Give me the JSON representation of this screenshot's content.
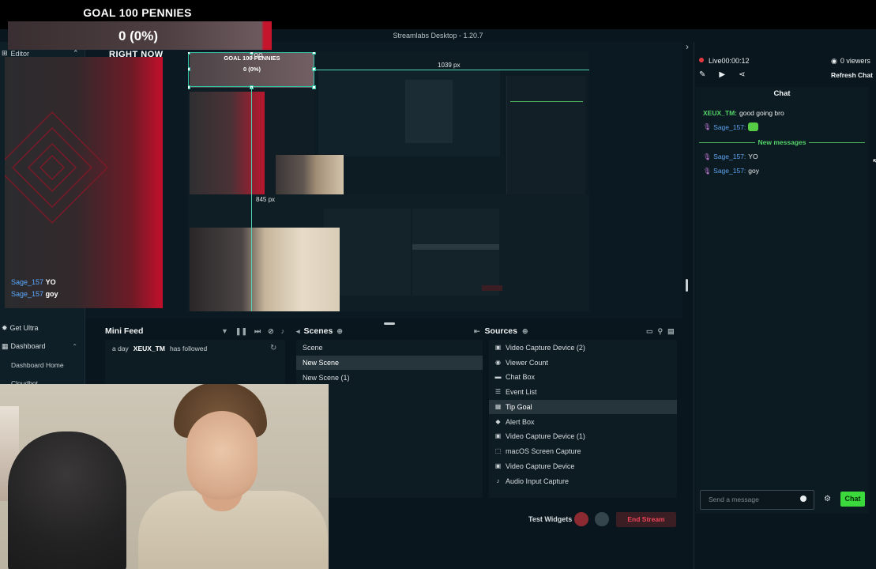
{
  "window": {
    "title": "Streamlabs Desktop - 1.20.7"
  },
  "goal_overlay": {
    "title": "GOAL 100 PENNIES",
    "value": "0 (0%)",
    "progress": 0,
    "subtitle": "RIGHT NOW"
  },
  "left_nav": {
    "editor_label": "Editor",
    "items": [
      {
        "label": "Get Ultra"
      },
      {
        "label": "Dashboard"
      },
      {
        "label": "Dashboard Home"
      },
      {
        "label": "Cloudbot"
      }
    ]
  },
  "preview": {
    "width_label": "1039 px",
    "height_label": "845 px",
    "nested_goal_title": "GOAL 100 PENNIES",
    "nested_goal_value": "0 (0%)",
    "nested_value_marker": "100"
  },
  "overlay_chat": [
    {
      "user": "Sage_157",
      "message": "YO"
    },
    {
      "user": "Sage_157",
      "message": "goy"
    }
  ],
  "mini_feed": {
    "title": "Mini Feed",
    "events": [
      {
        "time": "a day",
        "user": "XEUX_TM",
        "action": "has followed"
      }
    ]
  },
  "scenes": {
    "title": "Scenes",
    "items": [
      {
        "label": "Scene",
        "selected": false
      },
      {
        "label": "New Scene",
        "selected": true
      },
      {
        "label": "New Scene (1)",
        "selected": false
      }
    ]
  },
  "sources": {
    "title": "Sources",
    "items": [
      {
        "label": "Video Capture Device (2)",
        "icon": "camera-icon",
        "selected": false
      },
      {
        "label": "Viewer Count",
        "icon": "eye-icon",
        "selected": false
      },
      {
        "label": "Chat Box",
        "icon": "chat-icon",
        "selected": false
      },
      {
        "label": "Event List",
        "icon": "list-icon",
        "selected": false
      },
      {
        "label": "Tip Goal",
        "icon": "calendar-icon",
        "selected": true
      },
      {
        "label": "Alert Box",
        "icon": "bell-icon",
        "selected": false
      },
      {
        "label": "Video Capture Device (1)",
        "icon": "camera-icon",
        "selected": false
      },
      {
        "label": "macOS Screen Capture",
        "icon": "screen-capture-icon",
        "selected": false
      },
      {
        "label": "Video Capture Device",
        "icon": "camera-icon",
        "selected": false
      },
      {
        "label": "Audio Input Capture",
        "icon": "microphone-icon",
        "selected": false
      }
    ]
  },
  "footer": {
    "test_widgets": "Test Widgets",
    "end_stream": "End Stream"
  },
  "live_panel": {
    "status": "Live00:00:12",
    "viewers": "0 viewers",
    "refresh_chat": "Refresh Chat",
    "chat_header": "Chat",
    "new_messages": "New messages",
    "messages_before": [
      {
        "user": "XEUX_TM:",
        "text": "good going bro"
      },
      {
        "user": "Sage_157:",
        "text": ""
      }
    ],
    "messages_after": [
      {
        "user": "Sage_157:",
        "text": "YO"
      },
      {
        "user": "Sage_157:",
        "text": "goy"
      }
    ],
    "input_placeholder": "Send a message",
    "chat_button": "Chat"
  },
  "colors": {
    "accent_green": "#3cd93c",
    "live_red": "#e6393f",
    "end_stream_red": "#ef4458",
    "goal_red": "#c4152d"
  }
}
